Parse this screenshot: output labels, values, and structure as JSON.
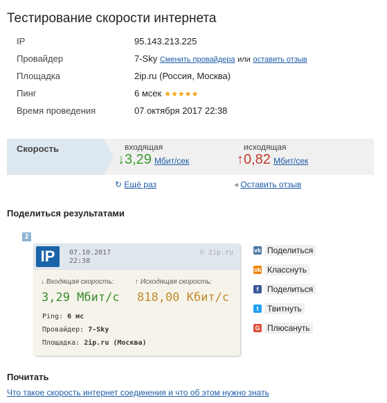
{
  "page_title": "Тестирование скорости интернета",
  "info": {
    "ip_label": "IP",
    "ip_value": "95.143.213.225",
    "provider_label": "Провайдер",
    "provider_value": "7-Sky",
    "change_provider_link": "Сменить провайдера",
    "or_text": "или",
    "leave_review_link": "оставить отзыв",
    "site_label": "Площадка",
    "site_value": "2ip.ru (Россия, Москва)",
    "ping_label": "Пинг",
    "ping_value": "6 мсек",
    "stars": "★★★★★",
    "time_label": "Время проведения",
    "time_value": "07 октября 2017 22:38"
  },
  "speed": {
    "label": "Скорость",
    "incoming_caption": "входящая",
    "incoming_arrow": "↓",
    "incoming_value": "3,29",
    "incoming_unit": "Мбит/сек",
    "outgoing_caption": "исходящая",
    "outgoing_arrow": "↑",
    "outgoing_value": "0,82",
    "outgoing_unit": "Мбит/сек"
  },
  "actions": {
    "again_icon": "↻",
    "again": "Ещё раз",
    "review_icon": "◂",
    "review": "Оставить отзыв"
  },
  "share": {
    "title": "Поделиться результатами",
    "badge": "2",
    "card": {
      "logo": "IP",
      "date": "07.10.2017",
      "time": "22:38",
      "site": "© 2ip.ru",
      "in_caption": "↓ Входящая скорость:",
      "out_caption": "↑ Исходящая скорость:",
      "in_value": "3,29 Мбит/с",
      "out_value": "818,00 Кбит/с",
      "ping_label": "Ping:",
      "ping_value": "6 мс",
      "provider_label": "Провайдер:",
      "provider_value": "7-Sky",
      "site_label": "Площадка:",
      "site_value": "2ip.ru (Москва)"
    },
    "buttons": [
      {
        "icon": "vk-icon",
        "glyph": "vk",
        "color": "#4c75a3",
        "label": "Поделиться"
      },
      {
        "icon": "odnoklassniki-icon",
        "glyph": "ok",
        "color": "#ee8208",
        "label": "Класснуть"
      },
      {
        "icon": "facebook-icon",
        "glyph": "f",
        "color": "#3b5998",
        "label": "Поделиться"
      },
      {
        "icon": "twitter-icon",
        "glyph": "t",
        "color": "#1da1f2",
        "label": "Твитнуть"
      },
      {
        "icon": "google-plus-icon",
        "glyph": "G",
        "color": "#dd4b39",
        "label": "Плюсануть"
      }
    ]
  },
  "read": {
    "title": "Почитать",
    "link": "Что такое скорость интернет соединения и что об этом нужно знать"
  }
}
